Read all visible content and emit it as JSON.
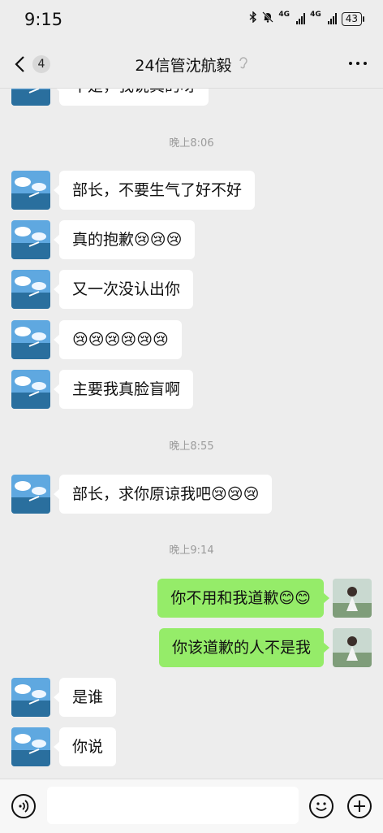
{
  "status": {
    "time": "9:15",
    "net1": "4G",
    "net2": "4G",
    "battery": "43"
  },
  "header": {
    "unread_count": "4",
    "title": "24信管沈航毅"
  },
  "messages": [
    {
      "side": "in",
      "text": "不是，我说真的呀"
    },
    {
      "type": "time",
      "text": "晚上8:06"
    },
    {
      "side": "in",
      "text": "部长，不要生气了好不好"
    },
    {
      "side": "in",
      "text": "真的抱歉😢😢😢"
    },
    {
      "side": "in",
      "text": "又一次没认出你"
    },
    {
      "side": "in",
      "text": "😢😢😢😢😢😢"
    },
    {
      "side": "in",
      "text": "主要我真脸盲啊"
    },
    {
      "type": "time",
      "text": "晚上8:55"
    },
    {
      "side": "in",
      "text": "部长，求你原谅我吧😢😢😢"
    },
    {
      "type": "time",
      "text": "晚上9:14"
    },
    {
      "side": "out",
      "text": "你不用和我道歉😊😊"
    },
    {
      "side": "out",
      "text": "你该道歉的人不是我"
    },
    {
      "side": "in",
      "text": "是谁"
    },
    {
      "side": "in",
      "text": "你说"
    }
  ],
  "input": {
    "value": ""
  },
  "colors": {
    "background": "#ededed",
    "incoming_bubble": "#ffffff",
    "outgoing_bubble": "#95ec69"
  },
  "icons": [
    "back-arrow-icon",
    "ear-icon",
    "more-icon",
    "voice-icon",
    "emoji-icon",
    "plus-icon",
    "bluetooth-icon",
    "mute-icon",
    "signal-icon",
    "battery-icon"
  ]
}
